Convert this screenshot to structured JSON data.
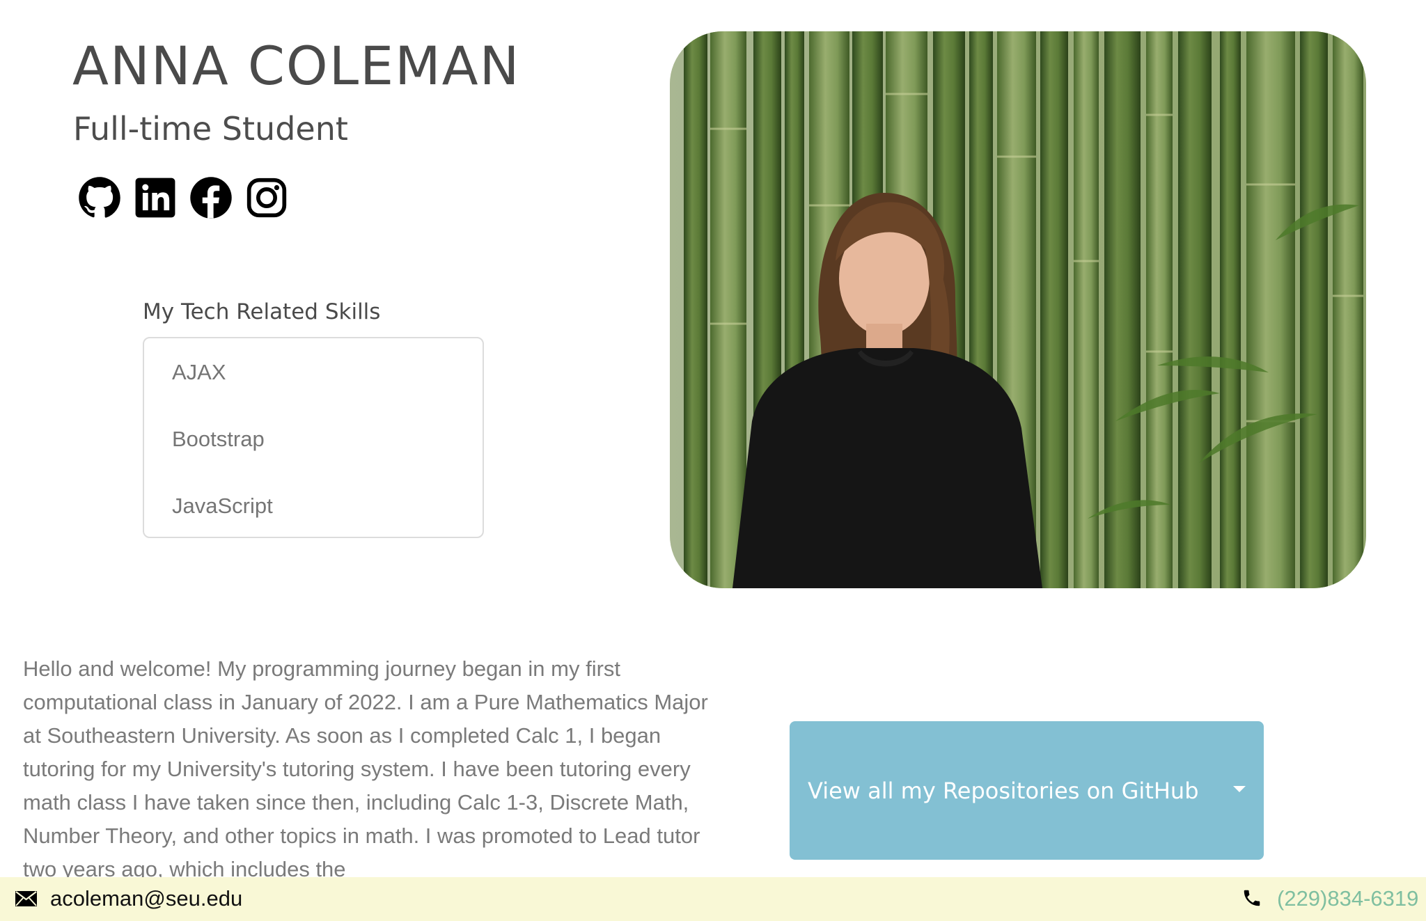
{
  "header": {
    "name": "ANNA COLEMAN",
    "role": "Full-time Student"
  },
  "social": {
    "links": [
      {
        "name": "github",
        "icon": "github-icon"
      },
      {
        "name": "linkedin",
        "icon": "linkedin-icon"
      },
      {
        "name": "facebook",
        "icon": "facebook-icon"
      },
      {
        "name": "instagram",
        "icon": "instagram-icon"
      }
    ]
  },
  "skills": {
    "heading": "My Tech Related Skills",
    "items": [
      "AJAX",
      "Bootstrap",
      "JavaScript"
    ]
  },
  "bio": {
    "text": "Hello and welcome! My programming journey began in my first computational class in January of 2022. I am a Pure Mathematics Major at Southeastern University. As soon as I completed Calc 1, I began tutoring for my University's tutoring system. I have been tutoring every math class I have taken since then, including Calc 1-3, Discrete Math, Number Theory, and other topics in math. I was promoted to Lead tutor two years ago, which includes the"
  },
  "repos": {
    "button_label": "View all my Repositories on GitHub",
    "icon": "caret-down-icon"
  },
  "footer": {
    "email": "acoleman@seu.edu",
    "phone": "(229)834-6319",
    "email_icon": "envelope-icon",
    "phone_icon": "phone-icon"
  },
  "colors": {
    "button_bg": "#83c0d3",
    "footer_bg": "#f9f8d6",
    "phone_text": "#7fbfa0",
    "heading_text": "#4a4a4a"
  }
}
